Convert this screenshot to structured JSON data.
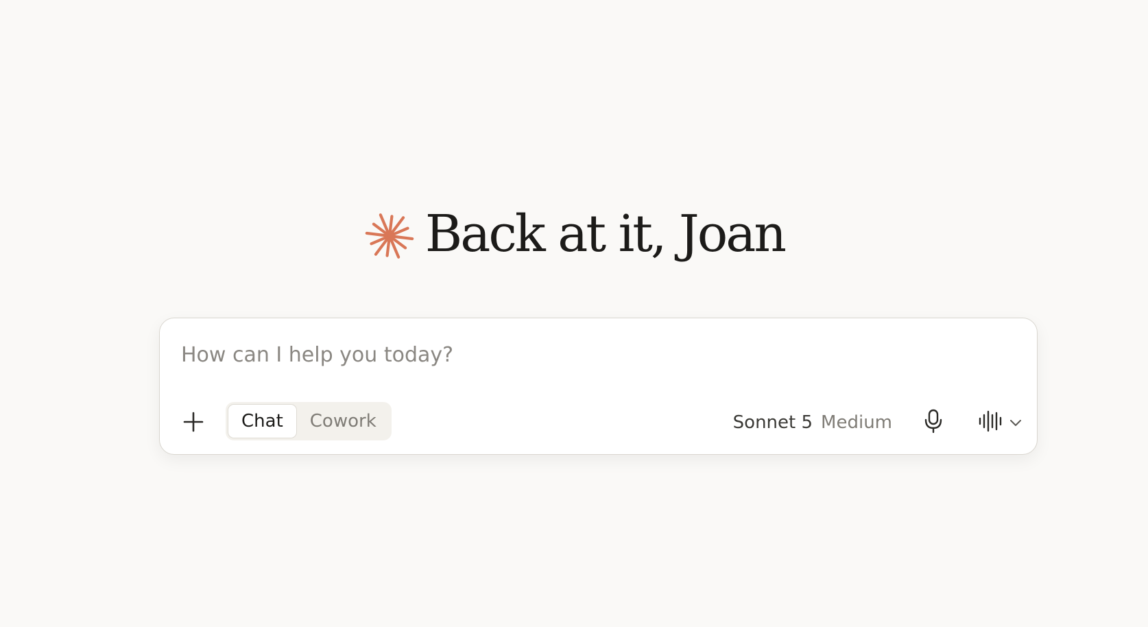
{
  "greeting": {
    "text": "Back at it, Joan",
    "icon": "spark-icon",
    "icon_color": "#d97757"
  },
  "composer": {
    "placeholder": "How can I help you today?",
    "value": "",
    "add_icon": "plus-icon",
    "modes": [
      {
        "label": "Chat",
        "active": true
      },
      {
        "label": "Cowork",
        "active": false
      }
    ],
    "model": {
      "name": "Sonnet 5",
      "effort": "Medium"
    },
    "mic_icon": "microphone-icon",
    "voice_icon": "voice-waveform-icon",
    "voice_menu_icon": "chevron-down-icon"
  },
  "colors": {
    "background": "#faf9f7",
    "accent": "#d97757",
    "text": "#1c1b19",
    "muted": "#7f7c76"
  }
}
